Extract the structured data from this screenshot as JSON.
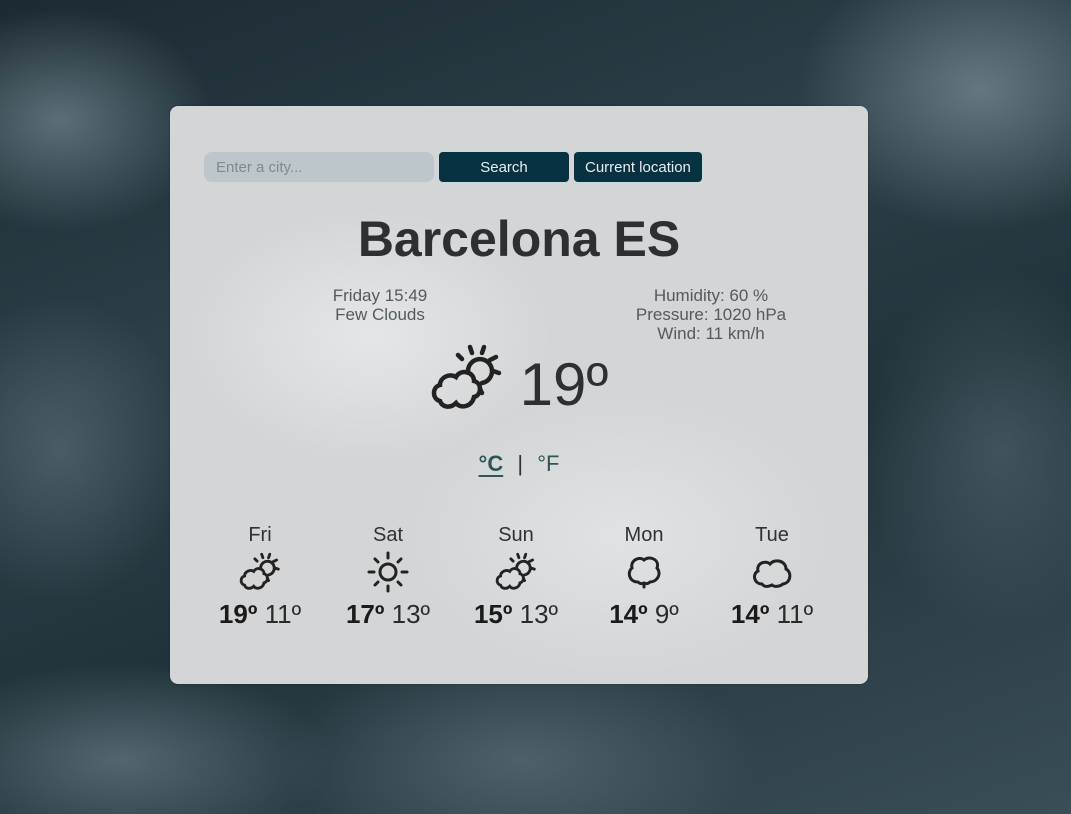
{
  "search": {
    "placeholder": "Enter a city...",
    "value": "",
    "search_label": "Search",
    "current_location_label": "Current location"
  },
  "city": "Barcelona ES",
  "details": {
    "datetime": "Friday 15:49",
    "description": "Few Clouds",
    "humidity": "Humidity: 60 %",
    "pressure": "Pressure: 1020 hPa",
    "wind": "Wind: 11 km/h"
  },
  "current": {
    "icon": "partly-cloudy-icon",
    "temperature": "19º"
  },
  "units": {
    "celsius": "°C",
    "separator": "|",
    "fahrenheit": "°F",
    "active": "celsius"
  },
  "forecast": [
    {
      "day": "Fri",
      "icon": "partly-cloudy-icon",
      "high": "19º",
      "low": "11º"
    },
    {
      "day": "Sat",
      "icon": "sun-icon",
      "high": "17º",
      "low": "13º"
    },
    {
      "day": "Sun",
      "icon": "partly-cloudy-icon",
      "high": "15º",
      "low": "13º"
    },
    {
      "day": "Mon",
      "icon": "cloud-rain-drop-icon",
      "high": "14º",
      "low": "9º"
    },
    {
      "day": "Tue",
      "icon": "cloud-icon",
      "high": "14º",
      "low": "11º"
    }
  ],
  "colors": {
    "button_bg": "#073241",
    "unit_link": "#2f5556"
  }
}
